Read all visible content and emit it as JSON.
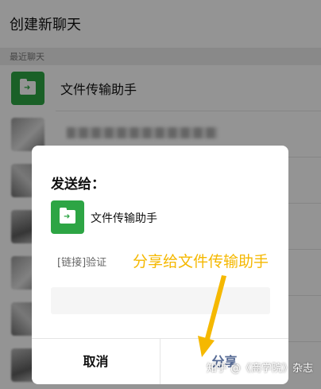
{
  "page": {
    "title": "创建新聊天",
    "section_label": "最近聊天"
  },
  "recent_chats": [
    {
      "name": "文件传输助手",
      "avatar": "folder-icon"
    }
  ],
  "dialog": {
    "title": "发送给：",
    "recipient": "文件传输助手",
    "link_preview": "[链接]验证",
    "message_value": "",
    "cancel_label": "取消",
    "share_label": "分享"
  },
  "annotation": {
    "text": "分享给文件传输助手",
    "color": "#f5b800"
  },
  "watermark": "知乎 @《商学院》杂志",
  "colors": {
    "wechat_green": "#2da544",
    "share_blue": "#576b95"
  }
}
